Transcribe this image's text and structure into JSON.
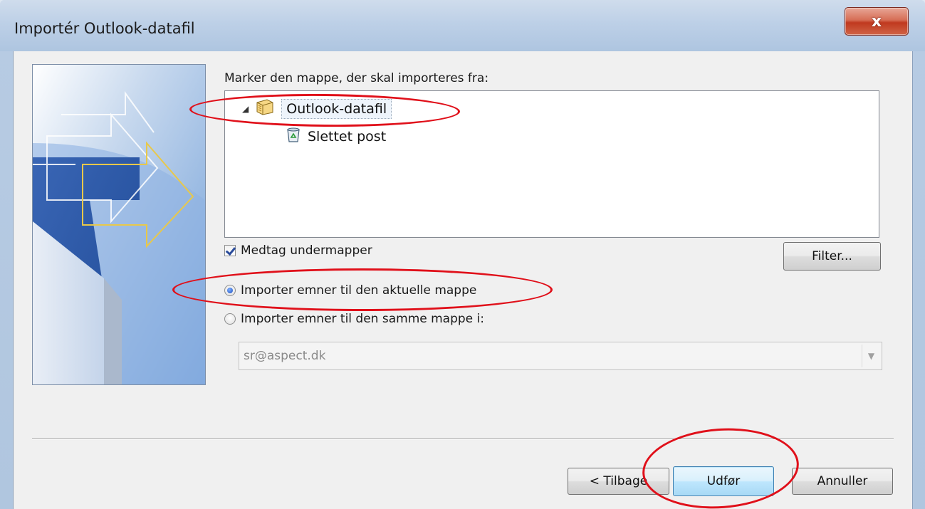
{
  "window": {
    "title": "Importér Outlook-datafil",
    "close_glyph": "x"
  },
  "prompt": {
    "label": "Marker den mappe, der skal importeres fra:"
  },
  "tree": {
    "root": {
      "label": "Outlook-datafil",
      "expander": "◢",
      "icon": "pst-file-icon"
    },
    "children": [
      {
        "label": "Slettet post",
        "icon": "recycle-bin-icon"
      }
    ]
  },
  "options": {
    "include_subfolders": {
      "label": "Medtag undermapper",
      "checked": true
    },
    "filter_button": "Filter...",
    "radio_current": {
      "label": "Importer emner til den aktuelle mappe",
      "selected": true
    },
    "radio_same": {
      "label": "Importer emner til den samme mappe i:",
      "selected": false
    },
    "account": {
      "value": "sr@aspect.dk",
      "arrow": "▼"
    }
  },
  "buttons": {
    "back": "< Tilbage",
    "finish": "Udfør",
    "cancel": "Annuller"
  },
  "colors": {
    "annotation": "#e0101a",
    "accent": "#3c7fb1"
  }
}
